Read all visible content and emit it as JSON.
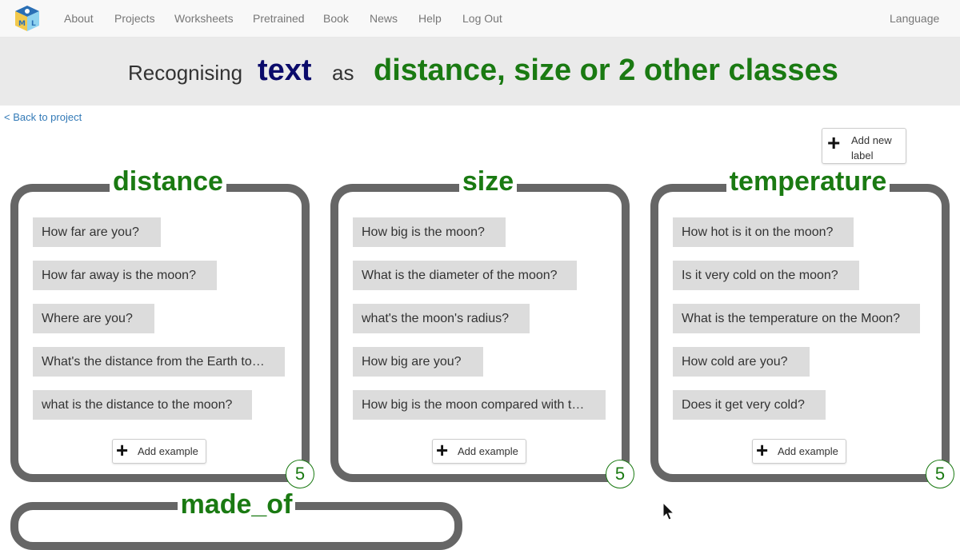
{
  "nav": {
    "items": [
      "About",
      "Projects",
      "Worksheets",
      "Pretrained",
      "Book",
      "News",
      "Help",
      "Log Out"
    ],
    "language": "Language"
  },
  "banner": {
    "recognising": "Recognising",
    "type": "text",
    "as": "as",
    "classes": "distance, size or 2 other classes"
  },
  "back_link": "< Back to project",
  "add_label": "Add new label",
  "add_example": "Add example",
  "buckets": [
    {
      "label": "distance",
      "count": "5",
      "examples": [
        "How far are you?",
        "How far away is the moon?",
        "Where are you?",
        "What's the distance from the Earth to…",
        "what is the distance to the moon?"
      ]
    },
    {
      "label": "size",
      "count": "5",
      "examples": [
        "How big is the moon?",
        "What is the diameter of the moon?",
        "what's the moon's radius?",
        "How big are you?",
        "How big is the moon compared with t…"
      ]
    },
    {
      "label": "temperature",
      "count": "5",
      "examples": [
        "How hot is it on the moon?",
        "Is it very cold on the moon?",
        "What is the temperature on the Moon?",
        "How cold are you?",
        "Does it get very cold?"
      ]
    },
    {
      "label": "made_of"
    }
  ],
  "colors": {
    "label_green": "#1a7a12",
    "type_navy": "#0b0b6b",
    "bucket_border": "#666666",
    "example_bg": "#dcdcdc"
  }
}
